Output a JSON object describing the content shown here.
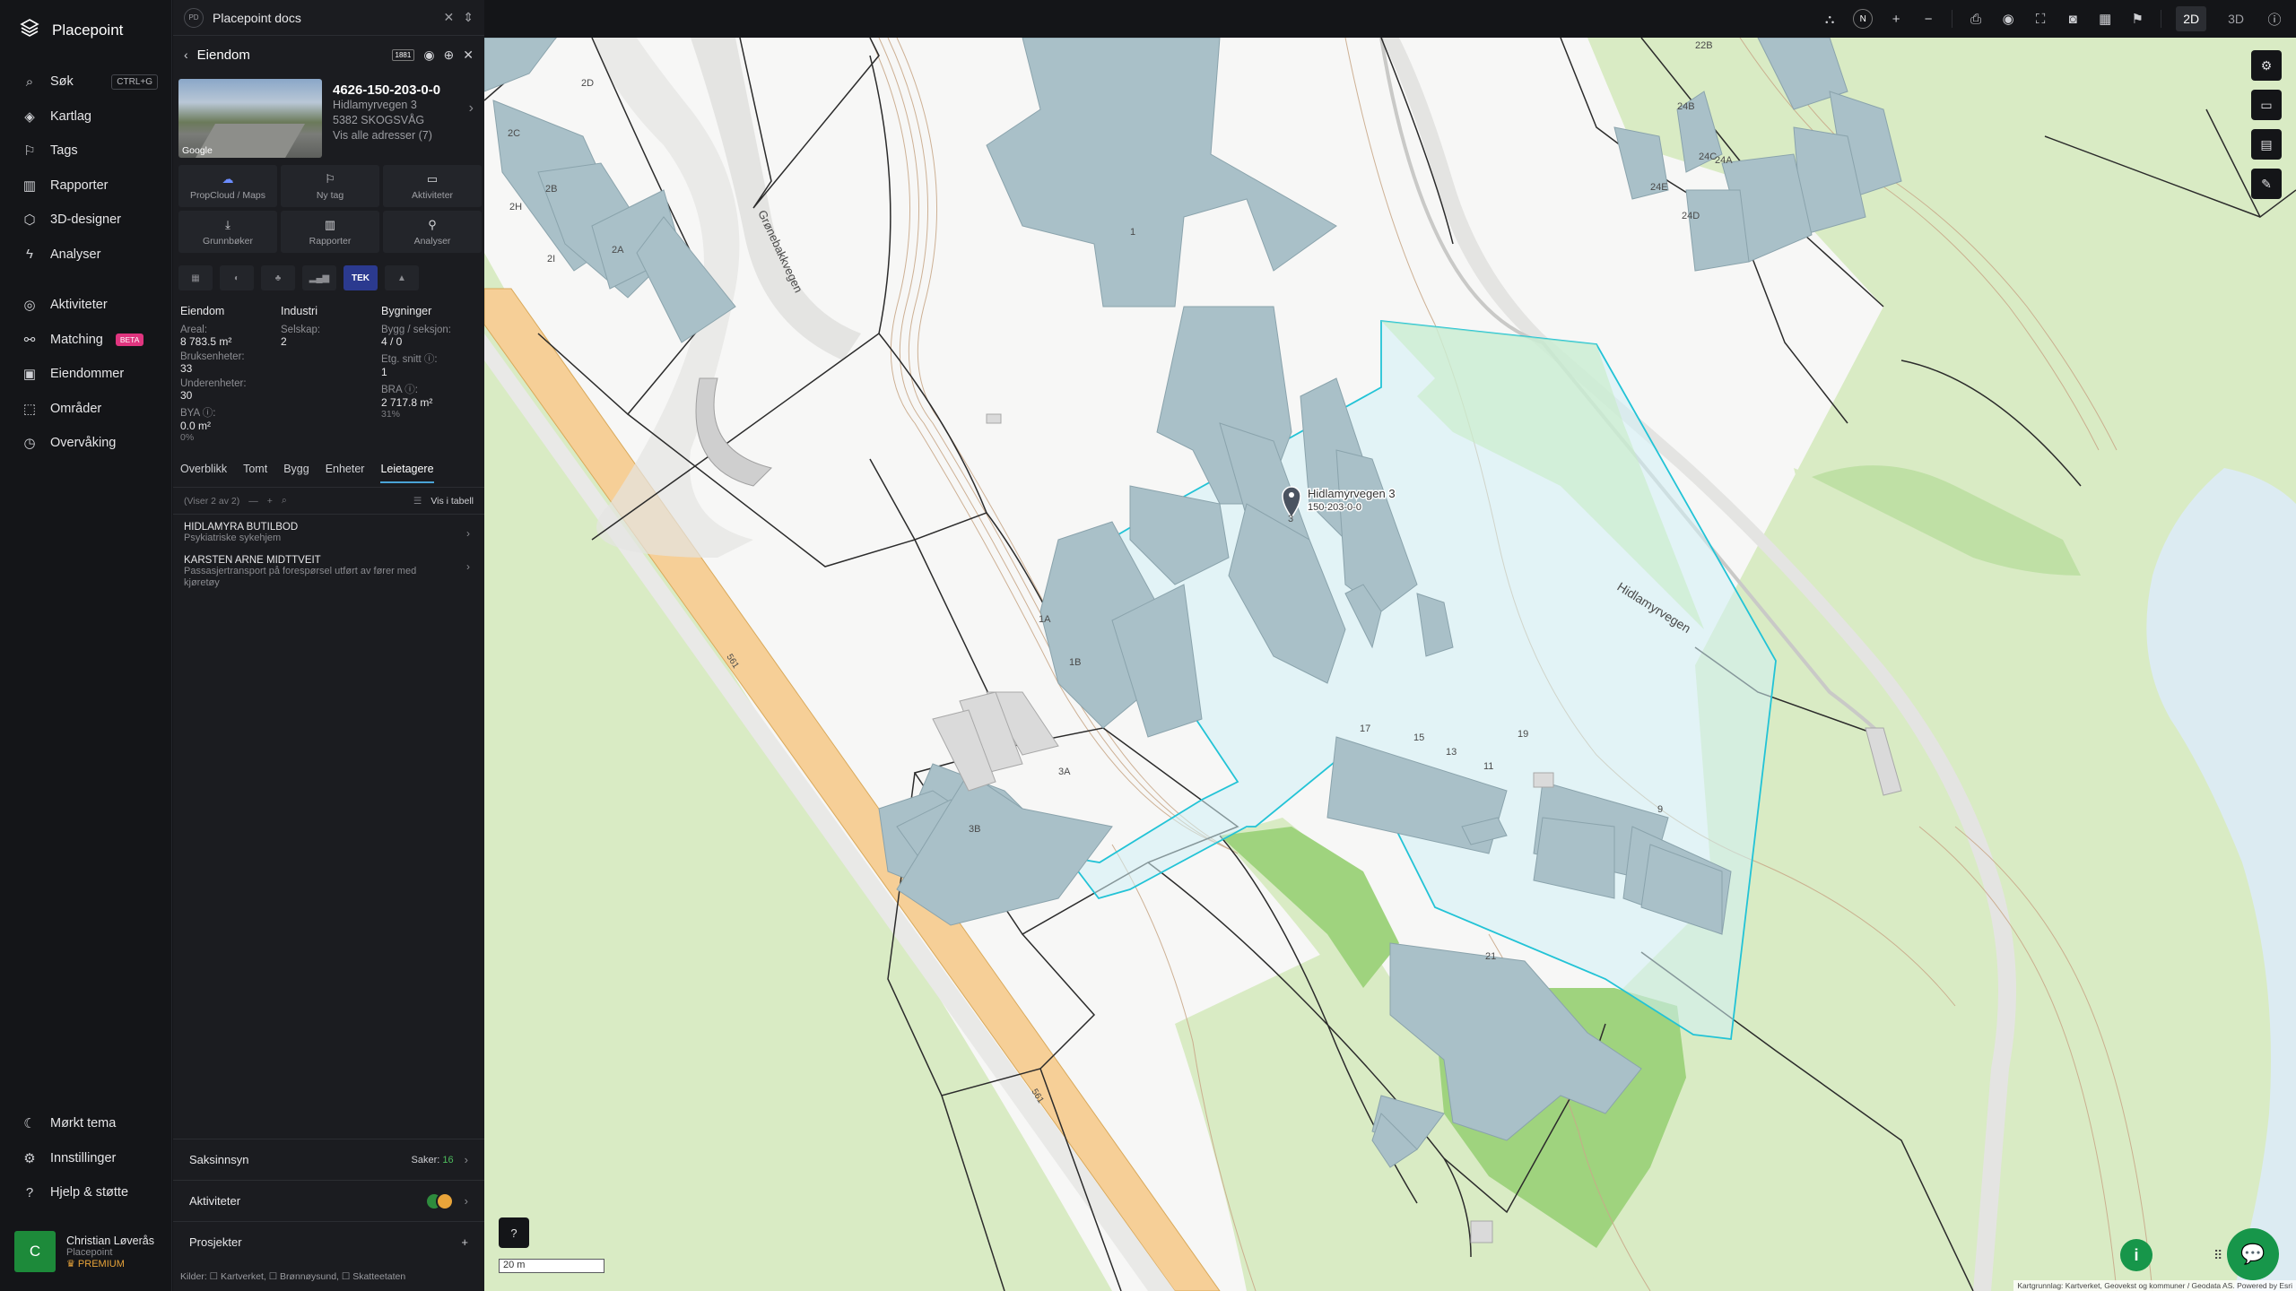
{
  "app": {
    "name": "Placepoint"
  },
  "nav": {
    "items": [
      {
        "icon": "search-icon",
        "label": "Søk",
        "shortcut": "CTRL+G"
      },
      {
        "icon": "layers-icon",
        "label": "Kartlag"
      },
      {
        "icon": "bookmark-icon",
        "label": "Tags"
      },
      {
        "icon": "bar-chart-icon",
        "label": "Rapporter"
      },
      {
        "icon": "cube-icon",
        "label": "3D-designer"
      },
      {
        "icon": "lightning-icon",
        "label": "Analyser"
      },
      {
        "icon": "activity-icon",
        "label": "Aktiviteter"
      },
      {
        "icon": "match-icon",
        "label": "Matching",
        "badge": "BETA"
      },
      {
        "icon": "building-icon",
        "label": "Eiendommer"
      },
      {
        "icon": "area-icon",
        "label": "Områder"
      },
      {
        "icon": "monitor-icon",
        "label": "Overvåking"
      }
    ],
    "bottom": [
      {
        "icon": "moon-icon",
        "label": "Mørkt tema"
      },
      {
        "icon": "gear-icon",
        "label": "Innstillinger"
      },
      {
        "icon": "help-icon",
        "label": "Hjelp & støtte"
      }
    ]
  },
  "user": {
    "initial": "C",
    "name": "Christian Løverås",
    "org": "Placepoint",
    "plan": "PREMIUM"
  },
  "panel": {
    "tab_badge": "PD",
    "tab_title": "Placepoint docs",
    "header": "Eiendom",
    "header_badge": "1881",
    "property": {
      "id": "4626-150-203-0-0",
      "street": "Hidlamyrvegen 3",
      "postal": "5382 SKOGSVÅG",
      "all_addresses": "Vis alle adresser (7)",
      "photo_label": "Google"
    },
    "actions": [
      {
        "icon": "cloud-icon",
        "label": "PropCloud / Maps"
      },
      {
        "icon": "tag-icon",
        "label": "Ny tag"
      },
      {
        "icon": "chat-icon",
        "label": "Aktiviteter"
      },
      {
        "icon": "download-icon",
        "label": "Grunnbøker"
      },
      {
        "icon": "chart-icon",
        "label": "Rapporter"
      },
      {
        "icon": "pin-icon",
        "label": "Analyser"
      }
    ],
    "layer_tabs": [
      "layer-1-icon",
      "layer-2-icon",
      "layer-3-icon",
      "layer-4-icon",
      "TEK",
      "layer-6-icon"
    ],
    "stats": {
      "col1": {
        "title": "Eiendom",
        "areal_label": "Areal:",
        "areal": "8 783.5 m²",
        "bruks_label": "Bruksenheter:",
        "bruks": "33",
        "under_label": "Underenheter:",
        "under": "30",
        "bya_label": "BYA ⓘ:",
        "bya": "0.0 m²",
        "bya_pct": "0%"
      },
      "col2": {
        "title": "Industri",
        "selskap_label": "Selskap:",
        "selskap": "2"
      },
      "col3": {
        "title": "Bygninger",
        "bygg_label": "Bygg / seksjon:",
        "bygg": "4 / 0",
        "etg_label": "Etg. snitt ⓘ:",
        "etg": "1",
        "bra_label": "BRA ⓘ:",
        "bra": "2 717.8 m²",
        "bra_pct": "31%"
      }
    },
    "tabs": [
      "Overblikk",
      "Tomt",
      "Bygg",
      "Enheter",
      "Leietagere"
    ],
    "active_tab": "Leietagere",
    "list": {
      "showing": "(Viser 2 av 2)",
      "table_toggle": "Vis i tabell"
    },
    "tenants": [
      {
        "name": "HIDLAMYRA BUTILBOD",
        "desc": "Psykiatriske sykehjem"
      },
      {
        "name": "KARSTEN ARNE MIDTTVEIT",
        "desc": "Passasjertransport på forespørsel utført av fører med kjøretøy"
      }
    ],
    "sections": [
      {
        "label": "Saksinnsyn",
        "meta_label": "Saker:",
        "meta_value": "16"
      },
      {
        "label": "Aktiviteter"
      },
      {
        "label": "Prosjekter"
      }
    ],
    "sources": "Kilder: ☐ Kartverket, ☐ Brønnøysund, ☐ Skatteetaten"
  },
  "map": {
    "labels": {
      "road1": "Grønebakkvegen",
      "road2": "Hidlamyrvegen",
      "marker_title": "Hidlamyrvegen 3",
      "marker_sub": "150-203-0-0",
      "marker_num": "3",
      "route1": "561",
      "route2": "561"
    },
    "building_labels": [
      "2D",
      "2C",
      "2B",
      "2H",
      "2I",
      "2A",
      "1",
      "1A",
      "1B",
      "3A",
      "3B",
      "17",
      "15",
      "13",
      "11",
      "19",
      "9",
      "21",
      "22B",
      "24B",
      "24C",
      "24A",
      "24E",
      "24D"
    ],
    "scale": "20 m",
    "attribution": "Kartgrunnlag: Kartverket, Geovekst og kommuner / Geodata AS. Powered by Esri",
    "mode": {
      "d2": "2D",
      "d3": "3D"
    },
    "compass": "N",
    "colors": {
      "parcel": "#22c3d6",
      "building": "#a9c0c8",
      "forest": "#d9ebc4",
      "grass": "#9fd37e",
      "road": "#f6cf97",
      "water": "#dcebf2"
    }
  }
}
